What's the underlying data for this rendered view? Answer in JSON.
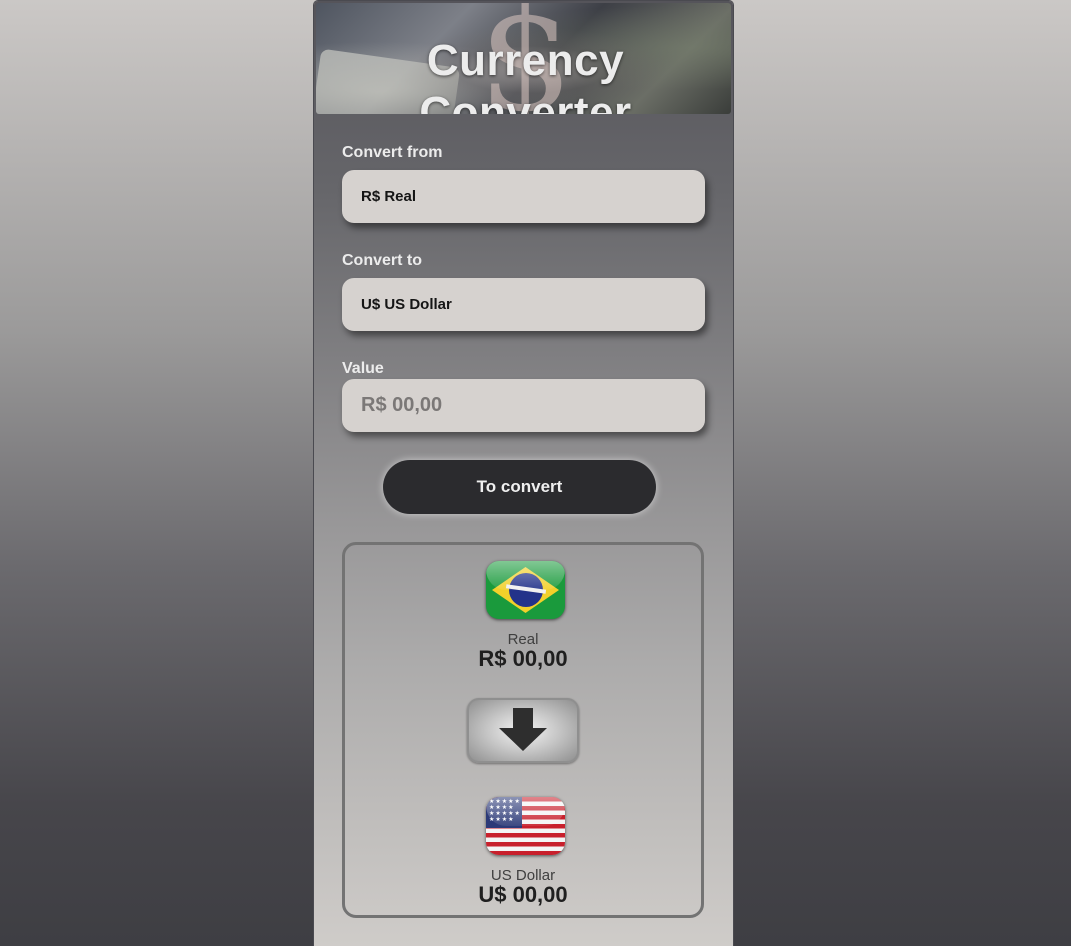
{
  "header": {
    "title": "Currency Converter"
  },
  "form": {
    "from_label": "Convert from",
    "from_value": "R$ Real",
    "to_label": "Convert to",
    "to_value": "U$ US Dollar",
    "value_label": "Value",
    "value_placeholder": "R$ 00,00",
    "convert_button": "To convert"
  },
  "result": {
    "from_flag_icon": "brazil-flag-icon",
    "from_currency_name": "Real",
    "from_amount": "R$ 00,00",
    "swap_icon": "arrow-down-icon",
    "to_flag_icon": "usa-flag-icon",
    "to_currency_name": "US Dollar",
    "to_amount": "U$ 00,00"
  }
}
